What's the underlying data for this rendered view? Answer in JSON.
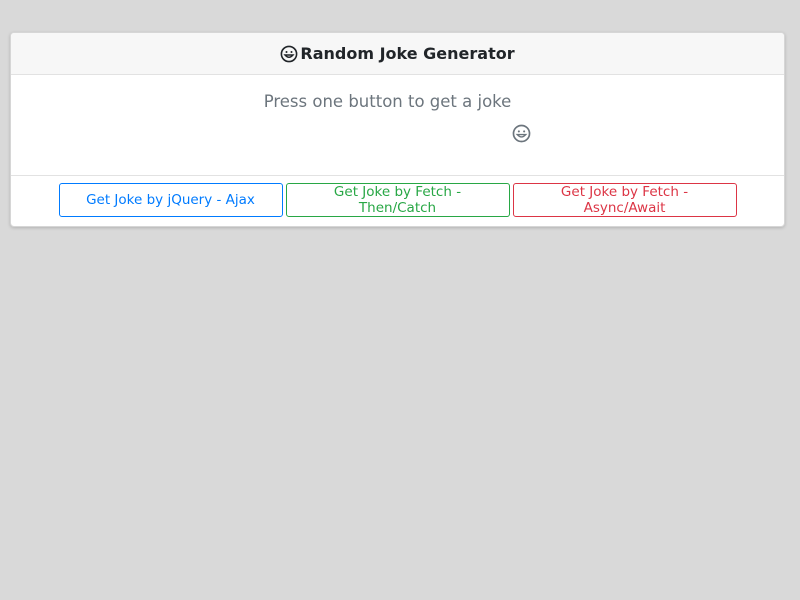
{
  "header": {
    "icon": "grinning-face-icon",
    "title": "Random Joke Generator"
  },
  "body": {
    "prompt_text": "Press one button to get a joke",
    "icon": "grinning-face-icon"
  },
  "footer": {
    "buttons": [
      {
        "label": "Get Joke by jQuery - Ajax",
        "color": "#007bff"
      },
      {
        "label": "Get Joke by Fetch - Then/Catch",
        "color": "#28a745"
      },
      {
        "label": "Get Joke by Fetch - Async/Await",
        "color": "#dc3545"
      }
    ]
  },
  "colors": {
    "page_background": "#d9d9d9",
    "card_background": "#ffffff",
    "header_background": "#f7f7f7",
    "muted_text": "#6c757d"
  }
}
